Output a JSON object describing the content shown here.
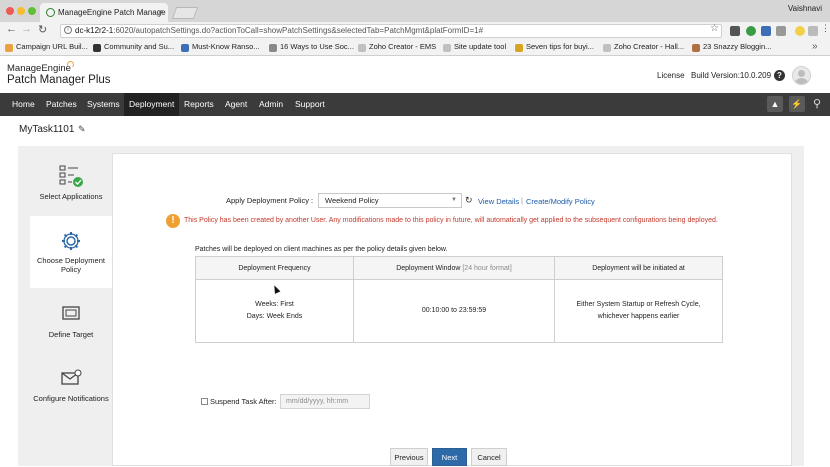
{
  "browser": {
    "tab_title": "ManageEngine Patch Manage",
    "tab_close": "×",
    "user": "Vaishnavi",
    "url_host": "dc-k12r2-1",
    "url_path": ":6020/autopatchSettings.do?actionToCall=showPatchSettings&selectedTab=PatchMgmt&platFormID=1#",
    "bookmarks": [
      {
        "label": "Campaign URL Buil...",
        "color": "#e8a33d"
      },
      {
        "label": "Community and Su...",
        "color": "#333333"
      },
      {
        "label": "Must-Know Ranso...",
        "color": "#3d6fb6"
      },
      {
        "label": "16 Ways to Use Soc...",
        "color": "#888888"
      },
      {
        "label": "Zoho Creator - EMS",
        "color": "#c0c0c0"
      },
      {
        "label": "Site update tool",
        "color": "#c0c0c0"
      },
      {
        "label": "Seven tips for buyi...",
        "color": "#d9a520"
      },
      {
        "label": "Zoho Creator - Hall...",
        "color": "#c0c0c0"
      },
      {
        "label": "23 Snazzy Bloggin...",
        "color": "#b07040"
      }
    ]
  },
  "header": {
    "logo_brand": "ManageEngine",
    "logo_product": "Patch Manager Plus",
    "license": "License",
    "build": "Build Version:10.0.209",
    "help": "?"
  },
  "menu": [
    "Home",
    "Patches",
    "Systems",
    "Deployment",
    "Reports",
    "Agent",
    "Admin",
    "Support"
  ],
  "task": {
    "title": "MyTask1101"
  },
  "steps": [
    {
      "label": "Select Applications"
    },
    {
      "label": "Choose Deployment Policy"
    },
    {
      "label": "Define Target"
    },
    {
      "label": "Configure Notifications"
    }
  ],
  "policy": {
    "label": "Apply Deployment Policy :",
    "selected": "Weekend Policy",
    "view_details": "View Details",
    "separator": "|",
    "create_modify": "Create/Modify Policy",
    "warning_icon": "!",
    "warning": "This Policy has been created by another User. Any modifications made to this policy in future, will automatically get applied to the subsequent configurations being deployed."
  },
  "details": {
    "intro": "Patches will be deployed on client machines as per the policy details given below.",
    "headers": [
      "Deployment Frequency",
      "Deployment Window",
      "[24 hour format]",
      "Deployment will be initiated at"
    ],
    "weeks": "Weeks:  First",
    "days": "Days:  Week Ends",
    "window": "00:10:00 to 23:59:59",
    "initiated": "Either System Startup or Refresh Cycle, whichever happens earlier"
  },
  "suspend": {
    "label": "Suspend Task After:",
    "placeholder": "mm/dd/yyyy, hh:mm"
  },
  "buttons": {
    "previous": "Previous",
    "next": "Next",
    "cancel": "Cancel"
  }
}
